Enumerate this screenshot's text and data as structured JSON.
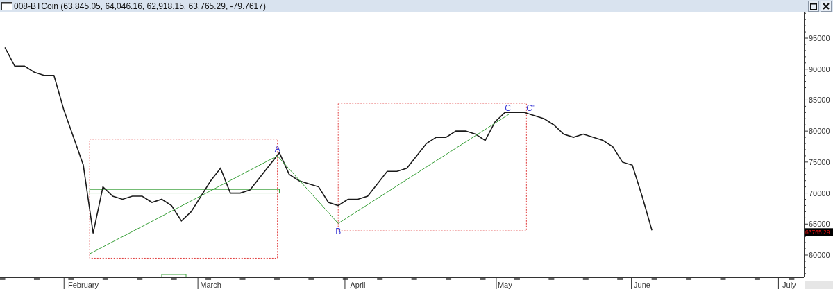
{
  "window": {
    "title": "008-BTCoin (63,845.05, 64,046.16, 62,918.15, 63,765.29, -79.7617)"
  },
  "chart": {
    "last_price": "63765.29",
    "chart_data": {
      "type": "line",
      "ylim": [
        56420,
        99140
      ],
      "categories": [
        null,
        null,
        null,
        null,
        null,
        null,
        null,
        null,
        "February",
        null,
        null,
        null,
        null,
        null,
        null,
        null,
        null,
        null,
        null,
        null,
        null,
        "March",
        null,
        null,
        null,
        null,
        null,
        null,
        null,
        null,
        null,
        null,
        null,
        null,
        null,
        null,
        "April",
        null,
        null,
        null,
        null,
        null,
        null,
        null,
        null,
        null,
        null,
        null,
        null,
        null,
        null,
        "May",
        null,
        null,
        null,
        null,
        null,
        null,
        null,
        null,
        null,
        null,
        null,
        null,
        null,
        "June",
        null,
        null,
        null,
        null,
        null,
        null,
        null,
        null,
        null,
        null,
        null,
        null,
        null,
        null,
        "July",
        null
      ],
      "yticks": [
        60000,
        65000,
        70000,
        75000,
        80000,
        85000,
        90000,
        95000
      ],
      "series": [
        {
          "color": "#1a1a1a",
          "values": [
            93500,
            90500,
            90500,
            89500,
            89000,
            89000,
            83500,
            79000,
            74500,
            63500,
            71000,
            69500,
            69000,
            69500,
            69500,
            68500,
            69000,
            68000,
            65500,
            67000,
            69500,
            72000,
            74000,
            70000,
            70000,
            70500,
            72500,
            74500,
            76500,
            73000,
            72000,
            71500,
            71000,
            68500,
            68000,
            69000,
            69000,
            69500,
            71500,
            73500,
            73500,
            74000,
            76000,
            78000,
            79000,
            79000,
            80000,
            80000,
            79500,
            78500,
            81500,
            83000,
            83000,
            83000,
            82500,
            82000,
            81000,
            79500,
            79000,
            79500,
            79000,
            78500,
            77500,
            75000,
            74500,
            69500,
            64000,
            null,
            null,
            null,
            null,
            null,
            null,
            null,
            null,
            null,
            null,
            null,
            null,
            null,
            null,
            null
          ]
        }
      ],
      "annotations": [
        "A",
        "B",
        "C",
        "C\""
      ]
    }
  }
}
